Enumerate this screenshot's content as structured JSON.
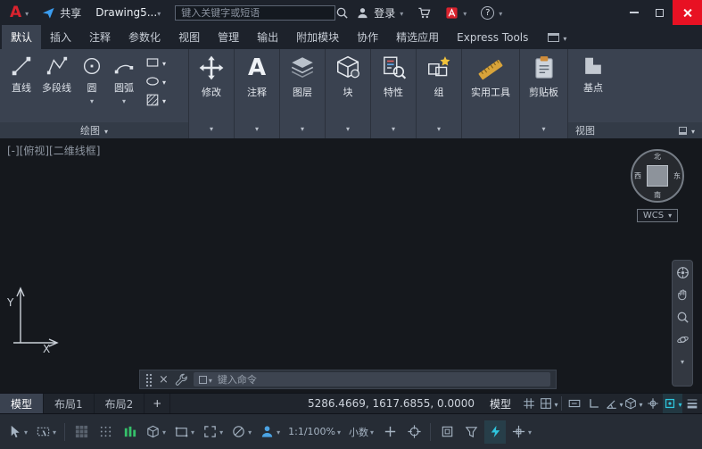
{
  "colors": {
    "titlebar_bg": "#1d222b",
    "ribbon_bg": "#3a4250",
    "panel_footer_bg": "#333b47",
    "canvas_bg": "#15181d",
    "statusbar_bg": "#262c35",
    "accent_teal": "#2fc6de",
    "close_red": "#e81123",
    "logo_red": "#d9232e",
    "share_blue": "#3b9df0",
    "star_yellow": "#f0c23c",
    "ruler_yellow": "#d9a43a",
    "clip_orange": "#cf8c3a",
    "cycling_green": "#35c06a",
    "person_blue": "#4ba3e3"
  },
  "titlebar": {
    "logo_letter": "A",
    "share_label": "共享",
    "doc_title": "Drawing5...",
    "search_placeholder": "键入关键字或短语",
    "signin_label": "登录",
    "help_label": "?"
  },
  "ribbon_tabs": {
    "items": [
      "默认",
      "插入",
      "注释",
      "参数化",
      "视图",
      "管理",
      "输出",
      "附加模块",
      "协作",
      "精选应用",
      "Express Tools"
    ]
  },
  "ribbon": {
    "draw_panel_label": "绘图",
    "line_label": "直线",
    "polyline_label": "多段线",
    "circle_label": "圆",
    "arc_label": "圆弧",
    "modify_label": "修改",
    "annotate_label": "注释",
    "layers_label": "图层",
    "block_label": "块",
    "properties_label": "特性",
    "group_label": "组",
    "utilities_label": "实用工具",
    "clipboard_label": "剪贴板",
    "basepoint_label": "基点",
    "view_panel_label": "视图"
  },
  "viewport": {
    "controls_label": "[-][俯视][二维线框]",
    "wcs_label": "WCS",
    "compass": {
      "n": "北",
      "s": "南",
      "e": "东",
      "w": "西"
    },
    "ucs": {
      "x": "X",
      "y": "Y"
    }
  },
  "command_line": {
    "placeholder": "键入命令"
  },
  "layout_tabs": {
    "model": "模型",
    "layout1": "布局1",
    "layout2": "布局2",
    "add": "+"
  },
  "status_bar": {
    "coordinates": "5286.4669, 1617.6855, 0.0000",
    "model_toggle": "模型",
    "annotation_scale": "1:1/100%",
    "units": "小数"
  }
}
